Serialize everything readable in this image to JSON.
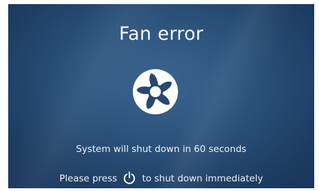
{
  "dialog": {
    "title": "Fan error",
    "countdown_text": "System will shut down in 60 seconds",
    "prompt_before": "Please press",
    "prompt_after": "to shut down immediately"
  },
  "icons": {
    "status_icon": "fan-icon",
    "button_icon": "power-icon"
  },
  "colors": {
    "background": "#2a5079",
    "text": "#ffffff"
  }
}
